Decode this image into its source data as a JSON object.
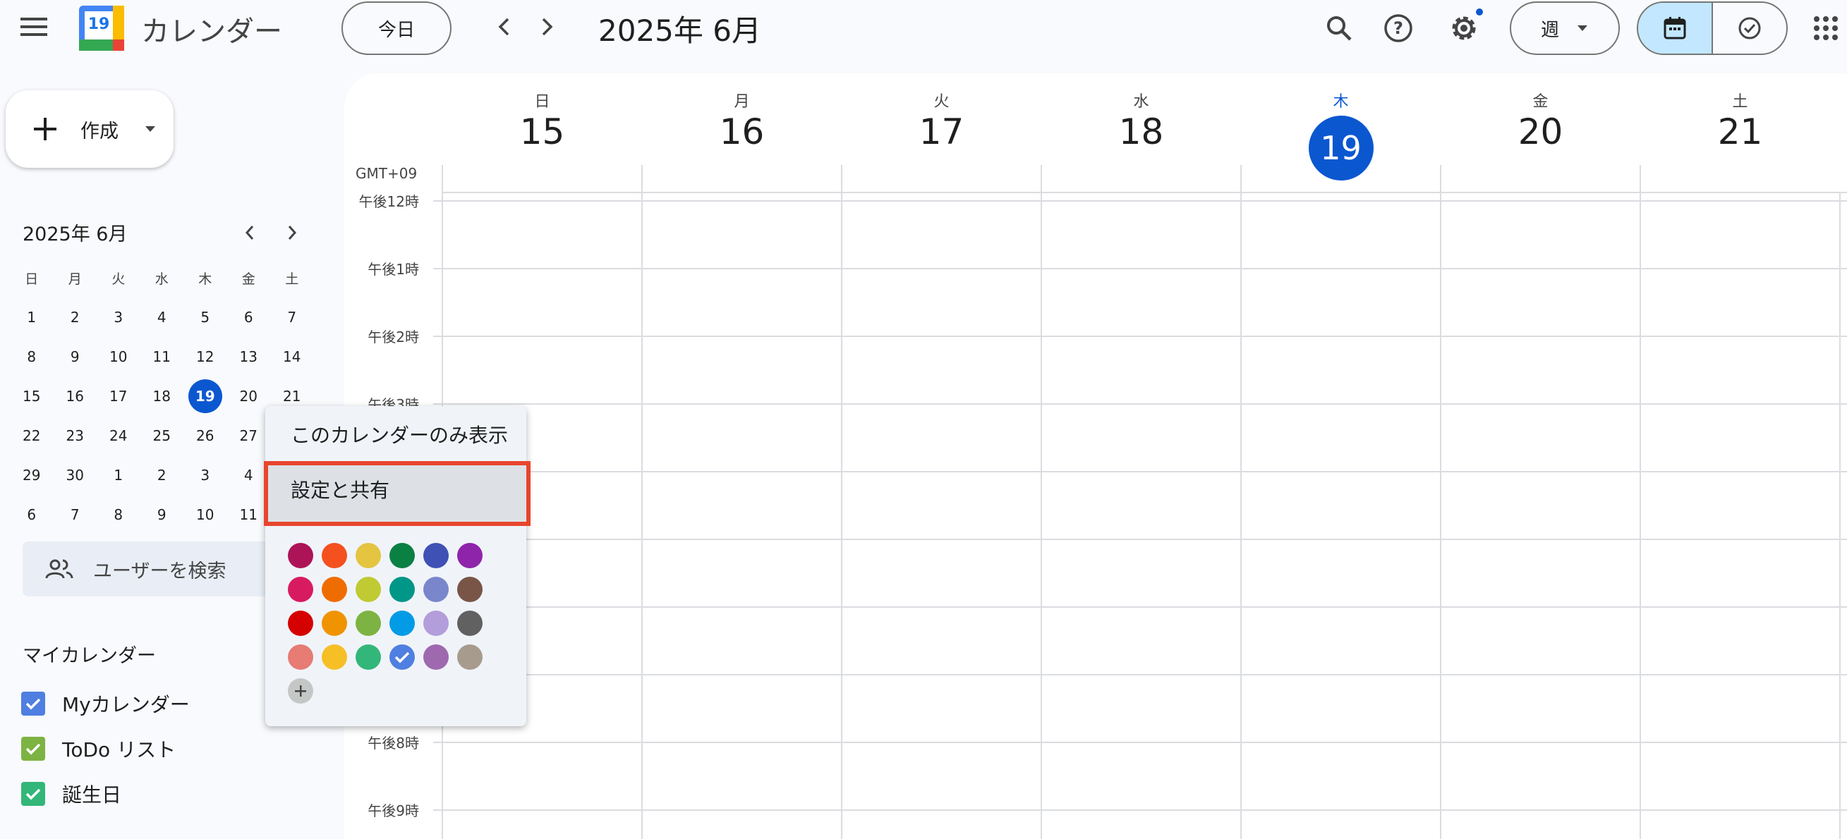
{
  "header": {
    "app_name": "カレンダー",
    "logo_day": "19",
    "today_button": "今日",
    "current_period": "2025年 6月",
    "view_selector": "週"
  },
  "sidebar": {
    "create_label": "作成",
    "mini_calendar": {
      "title": "2025年 6月",
      "weekdays": [
        "日",
        "月",
        "火",
        "水",
        "木",
        "金",
        "土"
      ],
      "weeks": [
        [
          "1",
          "2",
          "3",
          "4",
          "5",
          "6",
          "7"
        ],
        [
          "8",
          "9",
          "10",
          "11",
          "12",
          "13",
          "14"
        ],
        [
          "15",
          "16",
          "17",
          "18",
          "19",
          "20",
          "21"
        ],
        [
          "22",
          "23",
          "24",
          "25",
          "26",
          "27",
          ""
        ],
        [
          "29",
          "30",
          "1",
          "2",
          "3",
          "4",
          ""
        ],
        [
          "6",
          "7",
          "8",
          "9",
          "10",
          "11",
          ""
        ]
      ],
      "today": "19"
    },
    "search_people_placeholder": "ユーザーを検索",
    "my_calendars_title": "マイカレンダー",
    "calendars": [
      {
        "label": "Myカレンダー",
        "color": "#4f7fe0"
      },
      {
        "label": "ToDo リスト",
        "color": "#7cb342"
      },
      {
        "label": "誕生日",
        "color": "#33b679"
      }
    ]
  },
  "week": {
    "timezone": "GMT+09",
    "days": [
      {
        "name": "日",
        "num": "15"
      },
      {
        "name": "月",
        "num": "16"
      },
      {
        "name": "火",
        "num": "17"
      },
      {
        "name": "水",
        "num": "18"
      },
      {
        "name": "木",
        "num": "19"
      },
      {
        "name": "金",
        "num": "20"
      },
      {
        "name": "土",
        "num": "21"
      }
    ],
    "today_index": 4,
    "time_labels": [
      "午後12時",
      "午後1時",
      "午後2時",
      "午後3時",
      "",
      "",
      "",
      "",
      "午後8時",
      "午後9時"
    ]
  },
  "context_menu": {
    "show_only": "このカレンダーのみ表示",
    "settings_share": "設定と共有",
    "colors": [
      "#ad1457",
      "#f4511e",
      "#e4c441",
      "#0b8043",
      "#3f51b5",
      "#8e24aa",
      "#d81b60",
      "#ef6c00",
      "#c0ca33",
      "#009688",
      "#7986cb",
      "#795548",
      "#d50000",
      "#f09300",
      "#7cb342",
      "#039be5",
      "#b39ddb",
      "#616161",
      "#e67c73",
      "#f6bf26",
      "#33b679",
      "#4f7fe0",
      "#9e69af",
      "#a79b8e"
    ],
    "selected_color_index": 21
  },
  "colors": {
    "accent": "#0b57d0",
    "highlight_box": "#e8452c"
  }
}
